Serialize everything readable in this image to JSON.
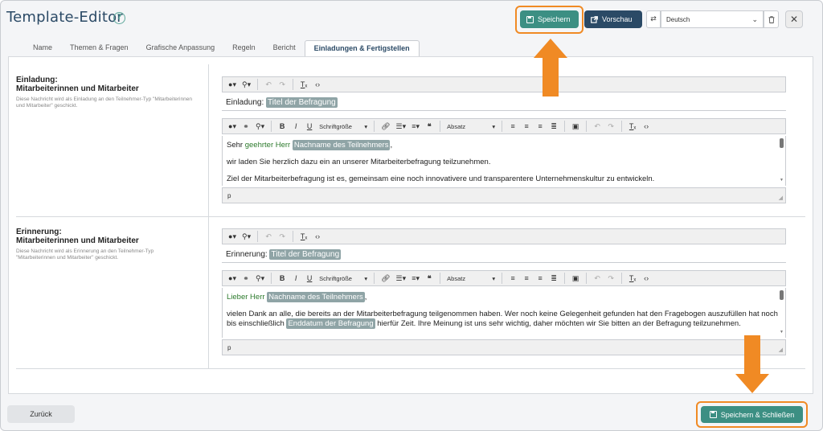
{
  "header": {
    "title": "Template-Editor",
    "help_glyph": "?",
    "save_label": "Speichern",
    "preview_label": "Vorschau",
    "language": "Deutsch",
    "close_glyph": "✕"
  },
  "tabs": [
    {
      "label": "Name"
    },
    {
      "label": "Themen & Fragen"
    },
    {
      "label": "Grafische Anpassung"
    },
    {
      "label": "Regeln"
    },
    {
      "label": "Bericht"
    },
    {
      "label": "Einladungen & Fertigstellen"
    }
  ],
  "toolbar": {
    "font_size_label": "Schriftgröße",
    "paragraph_label": "Absatz"
  },
  "invitation": {
    "title_line1": "Einladung:",
    "title_line2": "Mitarbeiterinnen und Mitarbeiter",
    "description": "Diese Nachricht wird als Einladung an den Teilnehmer-Typ \"Mitarbeiterinnen und Mitarbeiter\" geschickt.",
    "subject_prefix": "Einladung:",
    "subject_tag": "Titel der Befragung",
    "greeting_prefix": "Sehr ",
    "greeting_green": "geehrter Herr",
    "greeting_tag": "Nachname des Teilnehmers",
    "greeting_suffix": ",",
    "para1": "wir laden Sie herzlich dazu ein an unserer Mitarbeiterbefragung teilzunehmen.",
    "para2": "Ziel der Mitarbeiterbefragung ist es, gemeinsam eine noch innovativere und transparentere Unternehmenskultur zu entwickeln.",
    "status_path": "p"
  },
  "reminder": {
    "title_line1": "Erinnerung:",
    "title_line2": "Mitarbeiterinnen und Mitarbeiter",
    "description": "Diese Nachricht wird als Erinnerung an den Teilnehmer-Typ \"Mitarbeiterinnen und Mitarbeiter\" geschickt.",
    "subject_prefix": "Erinnerung:",
    "subject_tag": "Titel der Befragung",
    "greeting_green": "Lieber Herr",
    "greeting_tag": "Nachname des Teilnehmers",
    "greeting_suffix": ",",
    "para1_a": "vielen Dank an alle, die bereits an der Mitarbeiterbefragung teilgenommen haben. Wer noch keine Gelegenheit gefunden hat den Fragebogen auszufüllen hat noch bis einschließlich ",
    "para1_tag": "Enddatum der Befragung",
    "para1_b": " hierfür Zeit. Ihre Meinung ist uns sehr wichtig, daher möchten wir Sie bitten an der Befragung teilzunehmen.",
    "status_path": "p"
  },
  "footer": {
    "back_label": "Zurück",
    "save_close_label": "Speichern & Schließen"
  },
  "colors": {
    "primary": "#3c8f83",
    "navy": "#2b4a66",
    "highlight": "#f08a24",
    "tag": "#8fa4a6"
  }
}
